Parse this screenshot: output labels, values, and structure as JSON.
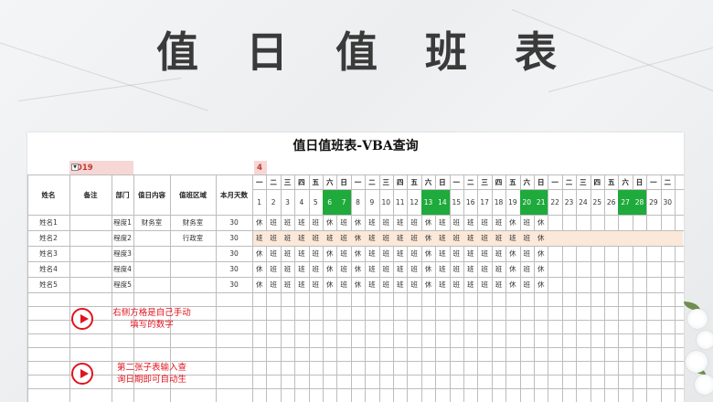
{
  "banner": {
    "title": "值日值班表"
  },
  "sheet": {
    "title": "值日值班表-VBA查询",
    "year": "2019",
    "month": "4",
    "headers": {
      "name": "姓名",
      "remark": "备注",
      "dept": "部门",
      "duty_content": "值日内容",
      "duty_area": "值班区域",
      "month_days": "本月天数"
    },
    "weekdays": [
      "一",
      "二",
      "三",
      "四",
      "五",
      "六",
      "日",
      "一",
      "二",
      "三",
      "四",
      "五",
      "六",
      "日",
      "一",
      "二",
      "三",
      "四",
      "五",
      "六",
      "日",
      "一",
      "二",
      "三",
      "四",
      "五",
      "六",
      "日",
      "一",
      "二"
    ],
    "dates": [
      "1",
      "2",
      "3",
      "4",
      "5",
      "6",
      "7",
      "8",
      "9",
      "10",
      "11",
      "12",
      "13",
      "14",
      "15",
      "16",
      "17",
      "18",
      "19",
      "20",
      "21",
      "22",
      "23",
      "24",
      "25",
      "26",
      "27",
      "28",
      "29",
      "30"
    ],
    "highlight_dates": [
      6,
      7,
      13,
      14,
      20,
      21,
      27,
      28
    ],
    "rows": [
      {
        "name": "姓名1",
        "remark": "",
        "dept": "程度1",
        "duty_content": "财务室",
        "duty_area": "财务室",
        "month_days": "30",
        "schedule": [
          "休",
          "班",
          "班",
          "班",
          "班",
          "休",
          "班",
          "休",
          "班",
          "班",
          "班",
          "班",
          "休",
          "班",
          "班",
          "班",
          "班",
          "班",
          "休",
          "班",
          "休"
        ]
      },
      {
        "name": "姓名2",
        "remark": "",
        "dept": "程度2",
        "duty_content": "",
        "duty_area": "行政室",
        "month_days": "30",
        "schedule": [
          "班",
          "班",
          "班",
          "班",
          "班",
          "班",
          "班",
          "休",
          "班",
          "班",
          "班",
          "班",
          "休",
          "班",
          "班",
          "班",
          "班",
          "班",
          "班",
          "班",
          "休"
        ]
      },
      {
        "name": "姓名3",
        "remark": "",
        "dept": "程度3",
        "duty_content": "",
        "duty_area": "",
        "month_days": "30",
        "schedule": [
          "休",
          "班",
          "班",
          "班",
          "班",
          "休",
          "班",
          "休",
          "班",
          "班",
          "班",
          "班",
          "休",
          "班",
          "班",
          "班",
          "班",
          "班",
          "休",
          "班",
          "休"
        ]
      },
      {
        "name": "姓名4",
        "remark": "",
        "dept": "程度4",
        "duty_content": "",
        "duty_area": "",
        "month_days": "30",
        "schedule": [
          "休",
          "班",
          "班",
          "班",
          "班",
          "休",
          "班",
          "休",
          "班",
          "班",
          "班",
          "班",
          "休",
          "班",
          "班",
          "班",
          "班",
          "班",
          "休",
          "班",
          "休"
        ]
      },
      {
        "name": "姓名5",
        "remark": "",
        "dept": "程度5",
        "duty_content": "",
        "duty_area": "",
        "month_days": "30",
        "schedule": [
          "休",
          "班",
          "班",
          "班",
          "班",
          "休",
          "班",
          "休",
          "班",
          "班",
          "班",
          "班",
          "休",
          "班",
          "班",
          "班",
          "班",
          "班",
          "休",
          "班",
          "休"
        ]
      }
    ],
    "notes": [
      {
        "line1": "右侧方格是自己手动",
        "line2": "填写的数字",
        "icon": "play-icon"
      },
      {
        "line1": "第二张子表输入查",
        "line2": "询日期即可自动生",
        "icon": "play-icon"
      }
    ]
  },
  "colors": {
    "weekend_green": "#1faa3c",
    "note_red": "#e0141e",
    "year_pink": "#f7d6d6"
  }
}
